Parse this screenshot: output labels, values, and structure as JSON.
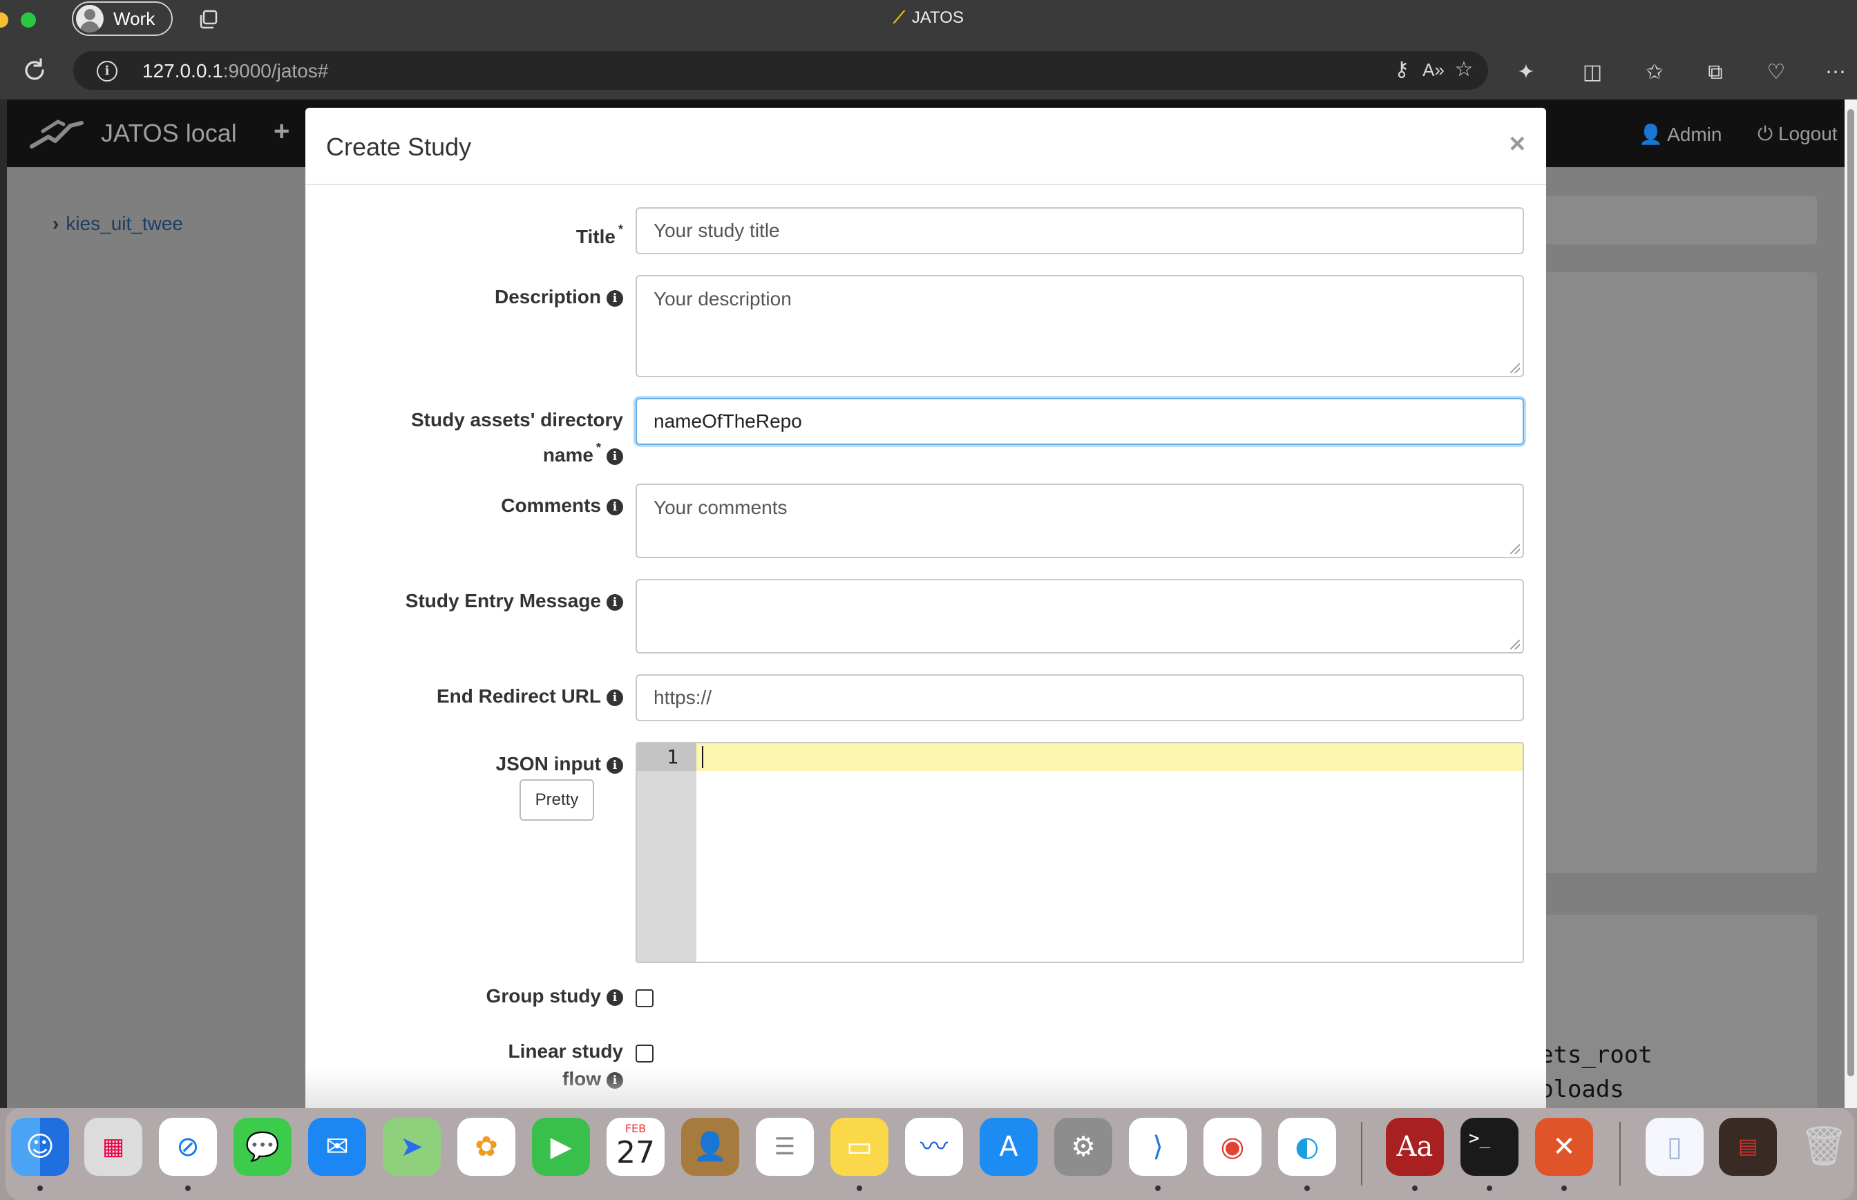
{
  "browser": {
    "profile_label": "Work",
    "window_title": "JATOS",
    "url_host": "127.0.0.1",
    "url_rest": ":9000/jatos#"
  },
  "app": {
    "brand": "JATOS local",
    "add_symbol": "+",
    "admin_label": "Admin",
    "logout_label": "Logout",
    "sidebar_items": [
      {
        "label": "kies_uit_twee"
      }
    ],
    "background_code_lines": [
      "ets_root",
      "ploads"
    ]
  },
  "modal": {
    "title": "Create Study",
    "close_symbol": "×",
    "required_mark": "*",
    "info_mark": "i",
    "fields": {
      "title": {
        "label": "Title",
        "placeholder": "Your study title",
        "value": ""
      },
      "description": {
        "label": "Description",
        "placeholder": "Your description",
        "value": ""
      },
      "assets_dir": {
        "label_line1": "Study assets' directory",
        "label_line2": "name",
        "value": "nameOfTheRepo"
      },
      "comments": {
        "label": "Comments",
        "placeholder": "Your comments",
        "value": ""
      },
      "entry_message": {
        "label": "Study Entry Message",
        "value": ""
      },
      "end_redirect": {
        "label": "End Redirect URL",
        "value": "https://"
      },
      "json_input": {
        "label": "JSON input",
        "pretty_button": "Pretty",
        "line_number": "1"
      },
      "group_study": {
        "label": "Group study",
        "checked": false
      },
      "linear_flow": {
        "label_line1": "Linear study",
        "label_line2": "flow",
        "checked": false
      }
    }
  },
  "dock": {
    "calendar_month": "FEB",
    "calendar_day": "27",
    "dictionary_label": "Aa",
    "terminal_label": ">_"
  },
  "colors": {
    "focus_ring": "#66afe9",
    "editor_active_line": "#fdf6b0",
    "navbar_bg": "#111111",
    "overlay_bg": "#7f7f7f"
  }
}
